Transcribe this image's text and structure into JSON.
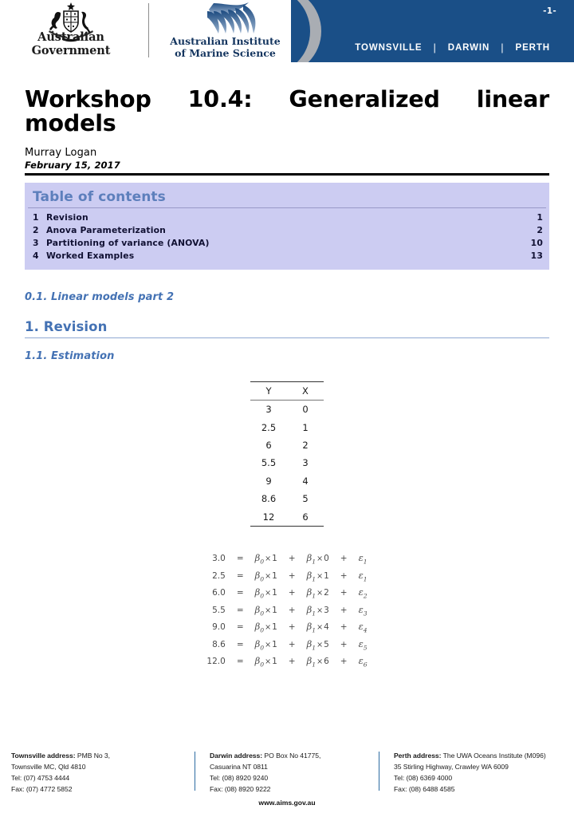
{
  "header": {
    "gov_logo_text": "Australian Government",
    "gov_logo_icon": "australian-coat-of-arms",
    "aims_logo_icon": "aims-wave-mark",
    "aims_line1": "Australian Institute",
    "aims_line2": "of Marine Science",
    "page_number": "-1-",
    "cities": [
      "TOWNSVILLE",
      "DARWIN",
      "PERTH"
    ],
    "separator": "|",
    "banner_color": "#1a4f87",
    "banner_curve_color": "#a9adb3"
  },
  "title": {
    "line1": "Workshop 10.4:  Generalized linear",
    "line2": "models",
    "author": "Murray Logan",
    "date": "February 15, 2017"
  },
  "toc": {
    "heading": "Table of contents",
    "background": "#ccccf2",
    "heading_color": "#5d7fbc",
    "entries": [
      {
        "num": "1",
        "label": "Revision",
        "page": "1"
      },
      {
        "num": "2",
        "label": "Anova Parameterization",
        "page": "2"
      },
      {
        "num": "3",
        "label": "Partitioning of variance (ANOVA)",
        "page": "10"
      },
      {
        "num": "4",
        "label": "Worked Examples",
        "page": "13"
      }
    ]
  },
  "sections": {
    "sub0": "0.1. Linear models part 2",
    "sec1": "1.  Revision",
    "sub1": "1.1. Estimation",
    "heading_color": "#4472b4"
  },
  "data_table": {
    "columns": [
      "Y",
      "X"
    ],
    "rows": [
      [
        "3",
        "0"
      ],
      [
        "2.5",
        "1"
      ],
      [
        "6",
        "2"
      ],
      [
        "5.5",
        "3"
      ],
      [
        "9",
        "4"
      ],
      [
        "8.6",
        "5"
      ],
      [
        "12",
        "6"
      ]
    ]
  },
  "equations": {
    "eq_symbol": "=",
    "plus_symbol": "+",
    "times_symbol": "×",
    "beta0_coef": "1",
    "rows": [
      {
        "lhs": "3.0",
        "beta1_x": "0",
        "err_sub": "1"
      },
      {
        "lhs": "2.5",
        "beta1_x": "1",
        "err_sub": "1"
      },
      {
        "lhs": "6.0",
        "beta1_x": "2",
        "err_sub": "2"
      },
      {
        "lhs": "5.5",
        "beta1_x": "3",
        "err_sub": "3"
      },
      {
        "lhs": "9.0",
        "beta1_x": "4",
        "err_sub": "4"
      },
      {
        "lhs": "8.6",
        "beta1_x": "5",
        "err_sub": "5"
      },
      {
        "lhs": "12.0",
        "beta1_x": "6",
        "err_sub": "6"
      }
    ]
  },
  "footer": {
    "townsville": {
      "label": "Townsville address:",
      "line1_rest": " PMB No 3,",
      "line2": "Townsville MC, Qld 4810",
      "line3": "Tel: (07) 4753 4444",
      "line4": "Fax: (07) 4772 5852"
    },
    "darwin": {
      "label": "Darwin address:",
      "line1_rest": " PO Box No 41775,",
      "line2": "Casuarina NT 0811",
      "line3": "Tel: (08) 8920 9240",
      "line4": "Fax: (08) 8920 9222"
    },
    "perth": {
      "label": "Perth address:",
      "line1_rest": " The UWA Oceans Institute (M096)",
      "line2": "35 Stirling Highway, Crawley WA 6009",
      "line3": "Tel: (08) 6369 4000",
      "line4": "Fax: (08) 6488 4585"
    },
    "website": "www.aims.gov.au"
  }
}
